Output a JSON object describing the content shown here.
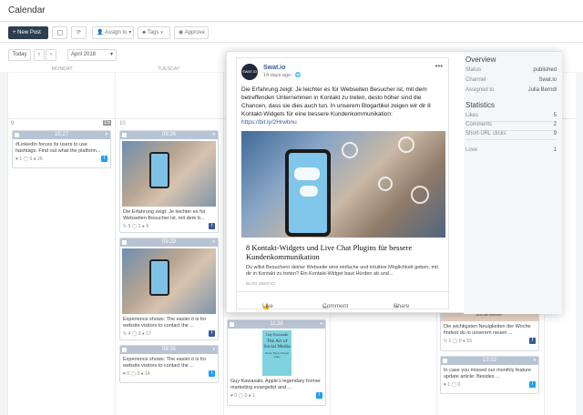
{
  "app": {
    "title": "Calendar"
  },
  "toolbar": {
    "new_post": "+ New Post",
    "assign": "Assign to",
    "tags": "Tags",
    "approve": "Approve"
  },
  "nav": {
    "today": "Today",
    "month": "April 2018"
  },
  "days": {
    "monday": "MONDAY",
    "tuesday": "TUESDAY"
  },
  "day_numbers": {
    "d9": "9",
    "d10": "10",
    "d15": "15"
  },
  "cards": [
    {
      "time": "15:27",
      "text": "#LinkedIn forces its users to use hashtags. Find out what the platform...",
      "stats": "♥ 1  ◯ 0  ● 26",
      "network": "twitter"
    },
    {
      "time": "09:26",
      "text": "Die Erfahrung zeigt: Je leichter es für Webseiten Besucher ist, mit dem b...",
      "stats": "↻ 5  ◯ 2  ● 9",
      "network": "facebook"
    },
    {
      "time": "09:29",
      "text": "Experience shows: The easier it is for website visitors to contact the ...",
      "stats": "↻ 4  ◯ 0  ● 17",
      "network": "facebook"
    },
    {
      "time": "09:35",
      "text": "Experience shows: The easier it is for website visitors to contact the ...",
      "stats": "♥ 0  ◯ 0  ● 14",
      "network": "twitter"
    },
    {
      "time": "11:28",
      "text": "Guy Kawasaki, Apple's legendary former marketing evangelist and ...",
      "stats": "♥ 0  ◯ 0  ● 1",
      "network": "twitter",
      "book_author": "Guy Kawasaki",
      "book_title": "The Art of Social Media",
      "book_sub": "Power Tips for Power Users"
    },
    {
      "time": "",
      "text": "Die wichtigsten Neuigkeiten der Woche findest du in unserem neuen ...",
      "stats": "↻ 2  ◯ 0  ● 53",
      "network": "facebook",
      "image_text": "Social Media"
    },
    {
      "time": "13:33",
      "text": "In case you missed our monthly feature update article: Besides ...",
      "stats": "♥ 1  ◯ 0",
      "network": "twitter"
    }
  ],
  "post": {
    "avatar": "SWAT.IO",
    "name": "Swat.io",
    "time": "14 days ago · ",
    "body": "Die Erfahrung zeigt: Je leichter es für Webseiten Besucher ist, mit dem betreffenden Unternehmen in Kontakt zu treten, desto höher sind die Chancen, dass sie dies auch tun. In unserem Blogartikel zeigen wir dir 8 Kontakt-Widgets für eine bessere Kundenkommunikation:",
    "link": "https://bit.ly/2Hrwbnu",
    "link_title": "8 Kontakt-Widgets und Live Chat Plugins für bessere Kundenkommunikation",
    "link_desc": "Du willst Besuchern deiner Webseite eine einfache und intuitive Möglichkeit geben, mit dir in Kontakt zu treten? Ein Kontakt-Widget baut Hürden ab und...",
    "domain": "BLOG.SWAT.IO",
    "like": "Like",
    "comment": "Comment",
    "share": "Share"
  },
  "overview": {
    "title": "Overview",
    "rows": [
      {
        "label": "Status",
        "value": "published"
      },
      {
        "label": "Channel",
        "value": "Swat.io"
      },
      {
        "label": "Assigned to",
        "value": "Julia Berndl"
      }
    ]
  },
  "statistics": {
    "title": "Statistics",
    "rows": [
      {
        "label": "Likes",
        "value": "5"
      },
      {
        "label": "Comments",
        "value": "2"
      },
      {
        "label": "Short-URL clicks",
        "value": "9"
      },
      {
        "label": "Love",
        "value": "1"
      }
    ]
  },
  "colors": {
    "primary": "#2d3e50",
    "card_head": "#b8c4d4",
    "facebook": "#3b5998",
    "twitter": "#1da1f2",
    "link": "#385898"
  }
}
